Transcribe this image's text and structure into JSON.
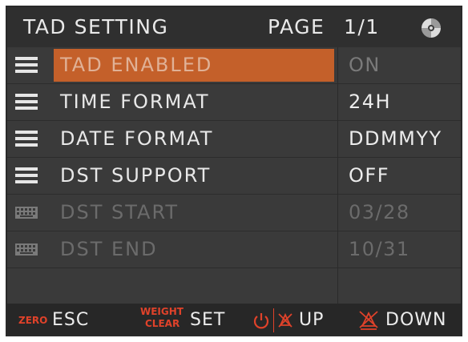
{
  "header": {
    "title": "TAD SETTING",
    "page_label": "PAGE",
    "page_number": "1/1",
    "disc_icon": "disc-icon"
  },
  "rows": [
    {
      "icon": "menu-lines-icon",
      "label": "TAD ENABLED",
      "value": "ON",
      "state": "selected"
    },
    {
      "icon": "menu-lines-icon",
      "label": "TIME FORMAT",
      "value": "24H",
      "state": "normal"
    },
    {
      "icon": "menu-lines-icon",
      "label": "DATE FORMAT",
      "value": "DDMMYY",
      "state": "normal"
    },
    {
      "icon": "menu-lines-icon",
      "label": "DST SUPPORT",
      "value": "OFF",
      "state": "normal"
    },
    {
      "icon": "keyboard-icon",
      "label": "DST START",
      "value": "03/28",
      "state": "disabled"
    },
    {
      "icon": "keyboard-icon",
      "label": "DST END",
      "value": "10/31",
      "state": "disabled"
    }
  ],
  "footer": {
    "esc_key": "ZERO",
    "esc_label": "ESC",
    "set_key_line1": "WEIGHT",
    "set_key_line2": "CLEAR",
    "set_label": "SET",
    "up_label": "UP",
    "down_label": "DOWN"
  },
  "colors": {
    "selected_highlight": "#c4602a",
    "key_red": "#e0422a",
    "background": "#3a3a3a"
  }
}
